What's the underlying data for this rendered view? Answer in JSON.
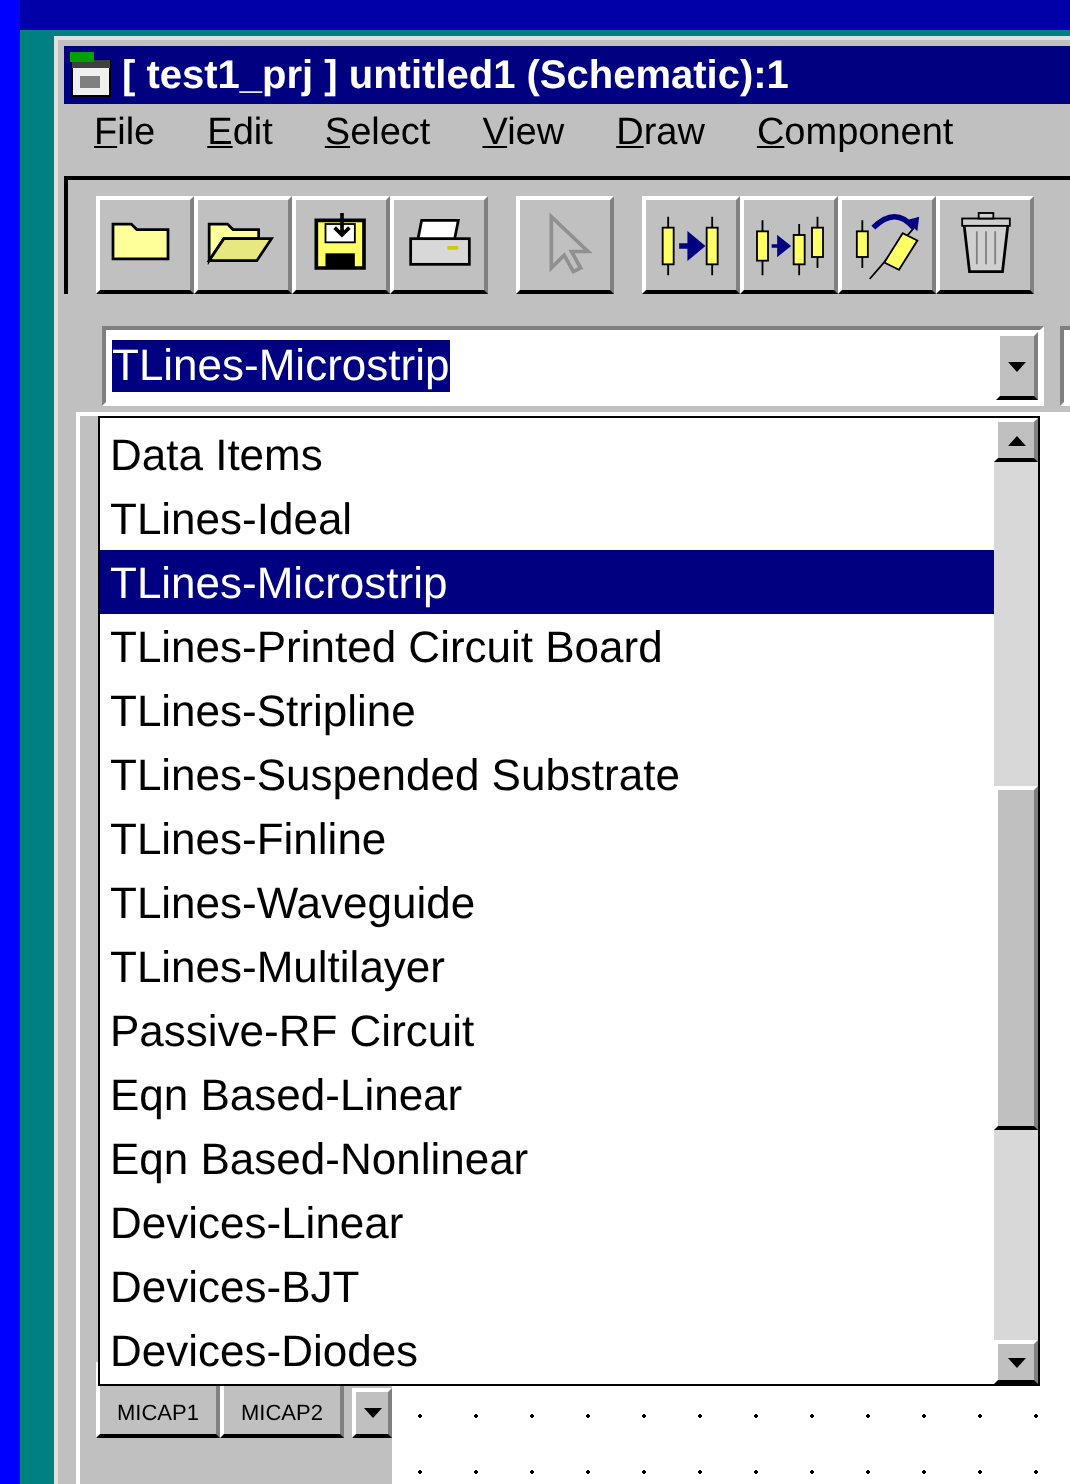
{
  "window": {
    "title": "[ test1_prj ] untitled1 (Schematic):1"
  },
  "menu": [
    {
      "mnemonic": "F",
      "rest": "ile"
    },
    {
      "mnemonic": "E",
      "rest": "dit"
    },
    {
      "mnemonic": "S",
      "rest": "elect"
    },
    {
      "mnemonic": "V",
      "rest": "iew"
    },
    {
      "mnemonic": "D",
      "rest": "raw"
    },
    {
      "mnemonic": "C",
      "rest": "omponent"
    }
  ],
  "toolbar": [
    {
      "kind": "folder",
      "disabled": false
    },
    {
      "kind": "open",
      "disabled": false
    },
    {
      "kind": "save",
      "disabled": false
    },
    {
      "kind": "print",
      "disabled": false
    },
    {
      "kind": "pointer",
      "disabled": true
    },
    {
      "kind": "insert",
      "disabled": false
    },
    {
      "kind": "insert2",
      "disabled": false
    },
    {
      "kind": "rotate",
      "disabled": false
    },
    {
      "kind": "delete",
      "disabled": false
    }
  ],
  "palette_combo": {
    "value": "TLines-Microstrip"
  },
  "palette_list": [
    {
      "label": "Data Items",
      "selected": false
    },
    {
      "label": "TLines-Ideal",
      "selected": false
    },
    {
      "label": "TLines-Microstrip",
      "selected": true
    },
    {
      "label": "TLines-Printed Circuit Board",
      "selected": false
    },
    {
      "label": "TLines-Stripline",
      "selected": false
    },
    {
      "label": "TLines-Suspended Substrate",
      "selected": false
    },
    {
      "label": "TLines-Finline",
      "selected": false
    },
    {
      "label": "TLines-Waveguide",
      "selected": false
    },
    {
      "label": "TLines-Multilayer",
      "selected": false
    },
    {
      "label": "Passive-RF Circuit",
      "selected": false
    },
    {
      "label": "Eqn Based-Linear",
      "selected": false
    },
    {
      "label": "Eqn Based-Nonlinear",
      "selected": false
    },
    {
      "label": "Devices-Linear",
      "selected": false
    },
    {
      "label": "Devices-BJT",
      "selected": false
    },
    {
      "label": "Devices-Diodes",
      "selected": false
    }
  ],
  "palette_buttons": [
    {
      "label": "MICAP1"
    },
    {
      "label": "MICAP2"
    }
  ]
}
